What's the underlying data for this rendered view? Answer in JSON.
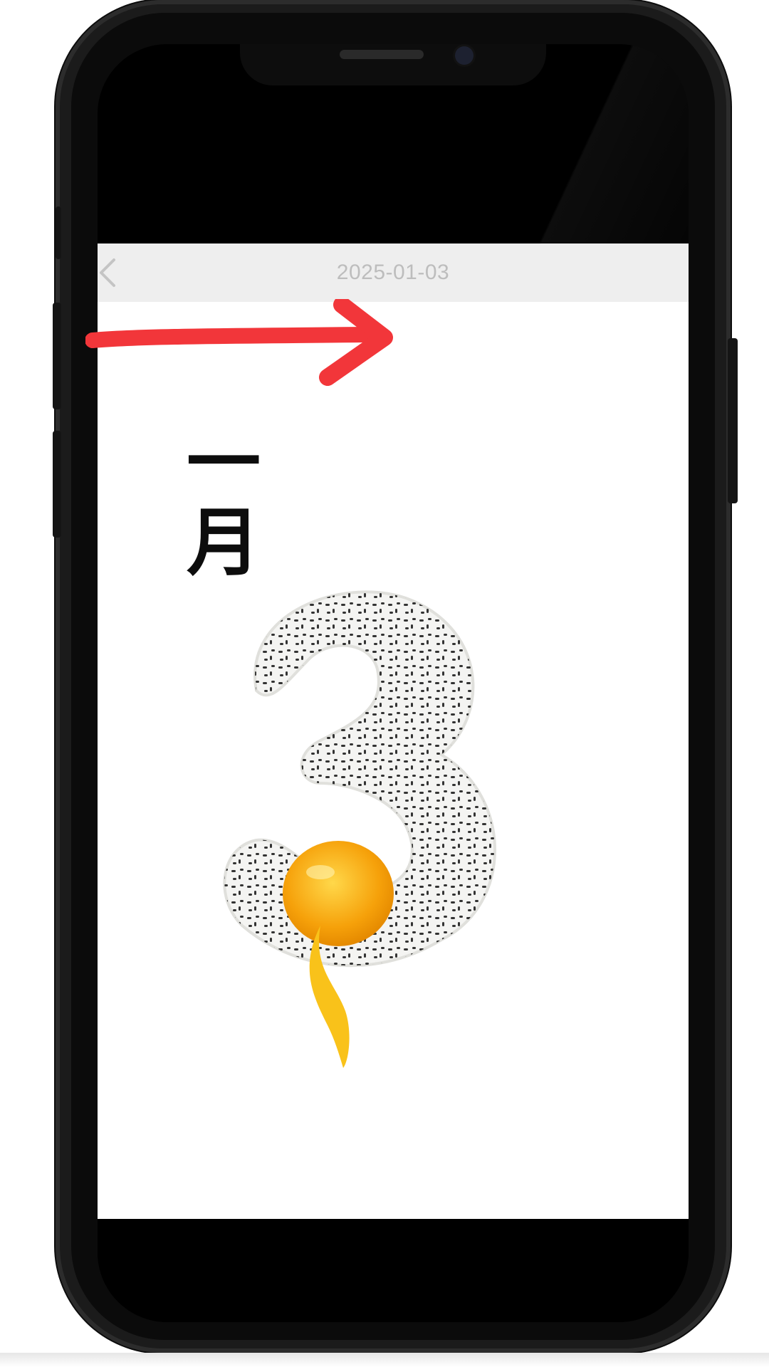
{
  "nav": {
    "title": "2025-01-03",
    "back_icon": "chevron-left-icon"
  },
  "calendar": {
    "month": "一月",
    "day_image": "number-3-fried-egg-illustration"
  },
  "annotation": {
    "icon": "red-arrow-right-icon",
    "color": "#f2363a"
  }
}
